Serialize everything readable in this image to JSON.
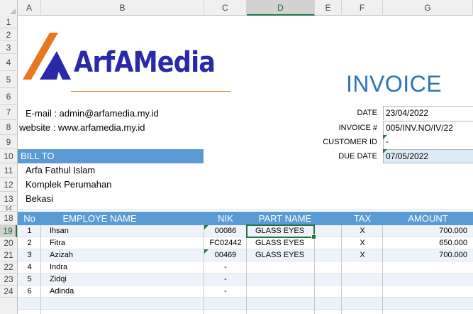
{
  "columns": [
    "A",
    "B",
    "C",
    "D",
    "E",
    "F",
    "G"
  ],
  "selected_column": "D",
  "rows": [
    "1",
    "2",
    "3",
    "4",
    "5",
    "6",
    "7",
    "8",
    "9",
    "10",
    "11",
    "12",
    "13",
    "14",
    "18",
    "19",
    "20",
    "21",
    "22",
    "23",
    "24"
  ],
  "selected_row": "19",
  "logo": {
    "text": "ArfAMedia",
    "colors": {
      "orange": "#e87722",
      "navy": "#2a2aa8"
    }
  },
  "title": "INVOICE",
  "contact": {
    "email": "E-mail  : admin@arfamedia.my.id",
    "website": "website : www.arfamedia.my.id"
  },
  "meta": {
    "date_label": "DATE",
    "date": "23/04/2022",
    "invoice_label": "INVOICE #",
    "invoice": "005/INV.NO/IV/22",
    "customer_label": "CUSTOMER ID",
    "customer": "-",
    "due_label": "DUE DATE",
    "due": "07/05/2022"
  },
  "bill_to": {
    "header": "BILL TO",
    "name": "Arfa Fathul Islam",
    "address1": "Komplek Perumahan",
    "address2": "Bekasi"
  },
  "table": {
    "headers": [
      "No",
      "EMPLOYE NAME",
      "NIK",
      "PART NAME",
      "TAX",
      "AMOUNT"
    ],
    "rows": [
      {
        "no": "1",
        "name": "Ihsan",
        "nik": "00086",
        "part": "GLASS EYES",
        "tax": "X",
        "amount": "700.000"
      },
      {
        "no": "2",
        "name": "Fitra",
        "nik": "FC02442",
        "part": "GLASS EYES",
        "tax": "X",
        "amount": "650.000"
      },
      {
        "no": "3",
        "name": "Azizah",
        "nik": "00469",
        "part": "GLASS EYES",
        "tax": "X",
        "amount": "700.000"
      },
      {
        "no": "4",
        "name": "Indra",
        "nik": "-",
        "part": "",
        "tax": "",
        "amount": ""
      },
      {
        "no": "5",
        "name": "Zidqi",
        "nik": "-",
        "part": "",
        "tax": "",
        "amount": ""
      },
      {
        "no": "6",
        "name": "Adinda",
        "nik": "-",
        "part": "",
        "tax": "",
        "amount": ""
      }
    ]
  },
  "accent_colors": {
    "table_header": "#5b9bd5",
    "title": "#2e74b5",
    "selection": "#217346"
  }
}
